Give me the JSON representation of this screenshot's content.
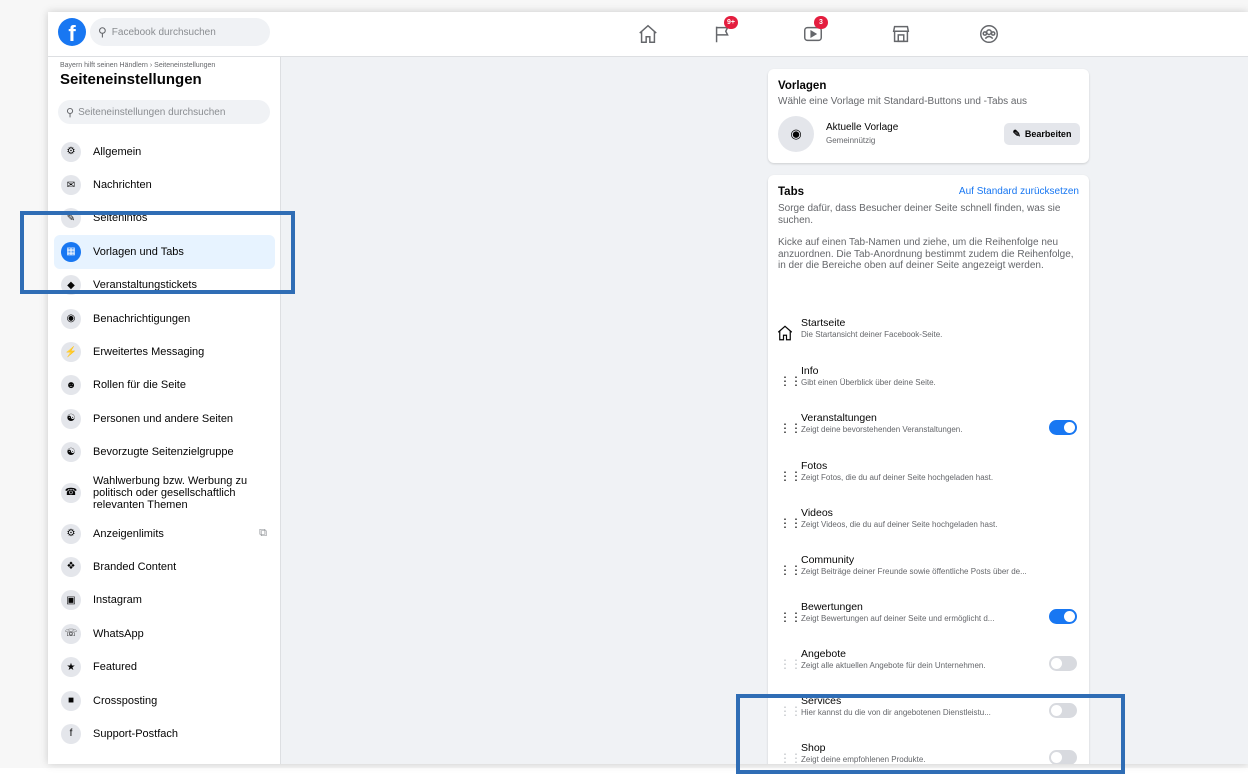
{
  "topbar": {
    "logo": "f",
    "search_placeholder": "Facebook durchsuchen",
    "nav": [
      {
        "name": "home-icon",
        "badge": ""
      },
      {
        "name": "flag-icon",
        "badge": "9+"
      },
      {
        "name": "video-icon",
        "badge": "3"
      },
      {
        "name": "marketplace-icon",
        "badge": ""
      },
      {
        "name": "groups-icon",
        "badge": ""
      }
    ]
  },
  "sidebar": {
    "breadcrumb": "Bayern hilft seinen Händlern › Seiteneinstellungen",
    "title": "Seiteneinstellungen",
    "search_placeholder": "Seiteneinstellungen durchsuchen",
    "items": [
      {
        "label": "Allgemein",
        "icon": "gear-icon"
      },
      {
        "label": "Nachrichten",
        "icon": "chat-icon"
      },
      {
        "label": "Seiteninfos",
        "icon": "pencil-icon"
      },
      {
        "label": "Vorlagen und Tabs",
        "icon": "grid-icon",
        "active": true
      },
      {
        "label": "Veranstaltungstickets",
        "icon": "ticket-icon"
      },
      {
        "label": "Benachrichtigungen",
        "icon": "globe-icon"
      },
      {
        "label": "Erweitertes Messaging",
        "icon": "messenger-icon"
      },
      {
        "label": "Rollen für die Seite",
        "icon": "person-icon"
      },
      {
        "label": "Personen und andere Seiten",
        "icon": "people-icon"
      },
      {
        "label": "Bevorzugte Seitenzielgruppe",
        "icon": "people-icon"
      },
      {
        "label": "Wahlwerbung bzw. Werbung zu politisch oder gesellschaftlich relevanten Themen",
        "icon": "megaphone-icon"
      },
      {
        "label": "Anzeigenlimits",
        "icon": "gear-icon",
        "external": true
      },
      {
        "label": "Branded Content",
        "icon": "handshake-icon"
      },
      {
        "label": "Instagram",
        "icon": "instagram-icon"
      },
      {
        "label": "WhatsApp",
        "icon": "whatsapp-icon"
      },
      {
        "label": "Featured",
        "icon": "star-icon"
      },
      {
        "label": "Crossposting",
        "icon": "camera-icon"
      },
      {
        "label": "Support-Postfach",
        "icon": "facebook-icon"
      }
    ]
  },
  "templates": {
    "title": "Vorlagen",
    "subtitle": "Wähle eine Vorlage mit Standard-Buttons und -Tabs aus",
    "current_label": "Aktuelle Vorlage",
    "current_value": "Gemeinnützig",
    "edit_label": "Bearbeiten"
  },
  "tabs": {
    "title": "Tabs",
    "reset_label": "Auf Standard zurücksetzen",
    "desc1": "Sorge dafür, dass Besucher deiner Seite schnell finden, was sie suchen.",
    "desc2": "Kicke auf einen Tab-Namen und ziehe, um die Reihenfolge neu anzuordnen. Die Tab-Anordnung bestimmt zudem die Reihenfolge, in der die Bereiche oben auf deiner Seite angezeigt werden.",
    "rows": [
      {
        "name": "Startseite",
        "desc": "Die Startansicht deiner Facebook-Seite.",
        "toggle": null,
        "home": true
      },
      {
        "name": "Info",
        "desc": "Gibt einen Überblick über deine Seite.",
        "toggle": null
      },
      {
        "name": "Veranstaltungen",
        "desc": "Zeigt deine bevorstehenden Veranstaltungen.",
        "toggle": true
      },
      {
        "name": "Fotos",
        "desc": "Zeigt Fotos, die du auf deiner Seite hochgeladen hast.",
        "toggle": null
      },
      {
        "name": "Videos",
        "desc": "Zeigt Videos, die du auf deiner Seite hochgeladen hast.",
        "toggle": null
      },
      {
        "name": "Community",
        "desc": "Zeigt Beiträge deiner Freunde sowie öffentliche Posts über de...",
        "toggle": null
      },
      {
        "name": "Bewertungen",
        "desc": "Zeigt Bewertungen auf deiner Seite und ermöglicht d...",
        "toggle": true
      },
      {
        "name": "Angebote",
        "desc": "Zeigt alle aktuellen Angebote für dein Unternehmen.",
        "toggle": false
      },
      {
        "name": "Services",
        "desc": "Hier kannst du die von dir angebotenen Dienstleistu...",
        "toggle": false
      },
      {
        "name": "Shop",
        "desc": "Zeigt deine empfohlenen Produkte.",
        "toggle": false
      }
    ]
  },
  "colors": {
    "accent": "#1877f2",
    "highlight": "#2f6db5"
  }
}
